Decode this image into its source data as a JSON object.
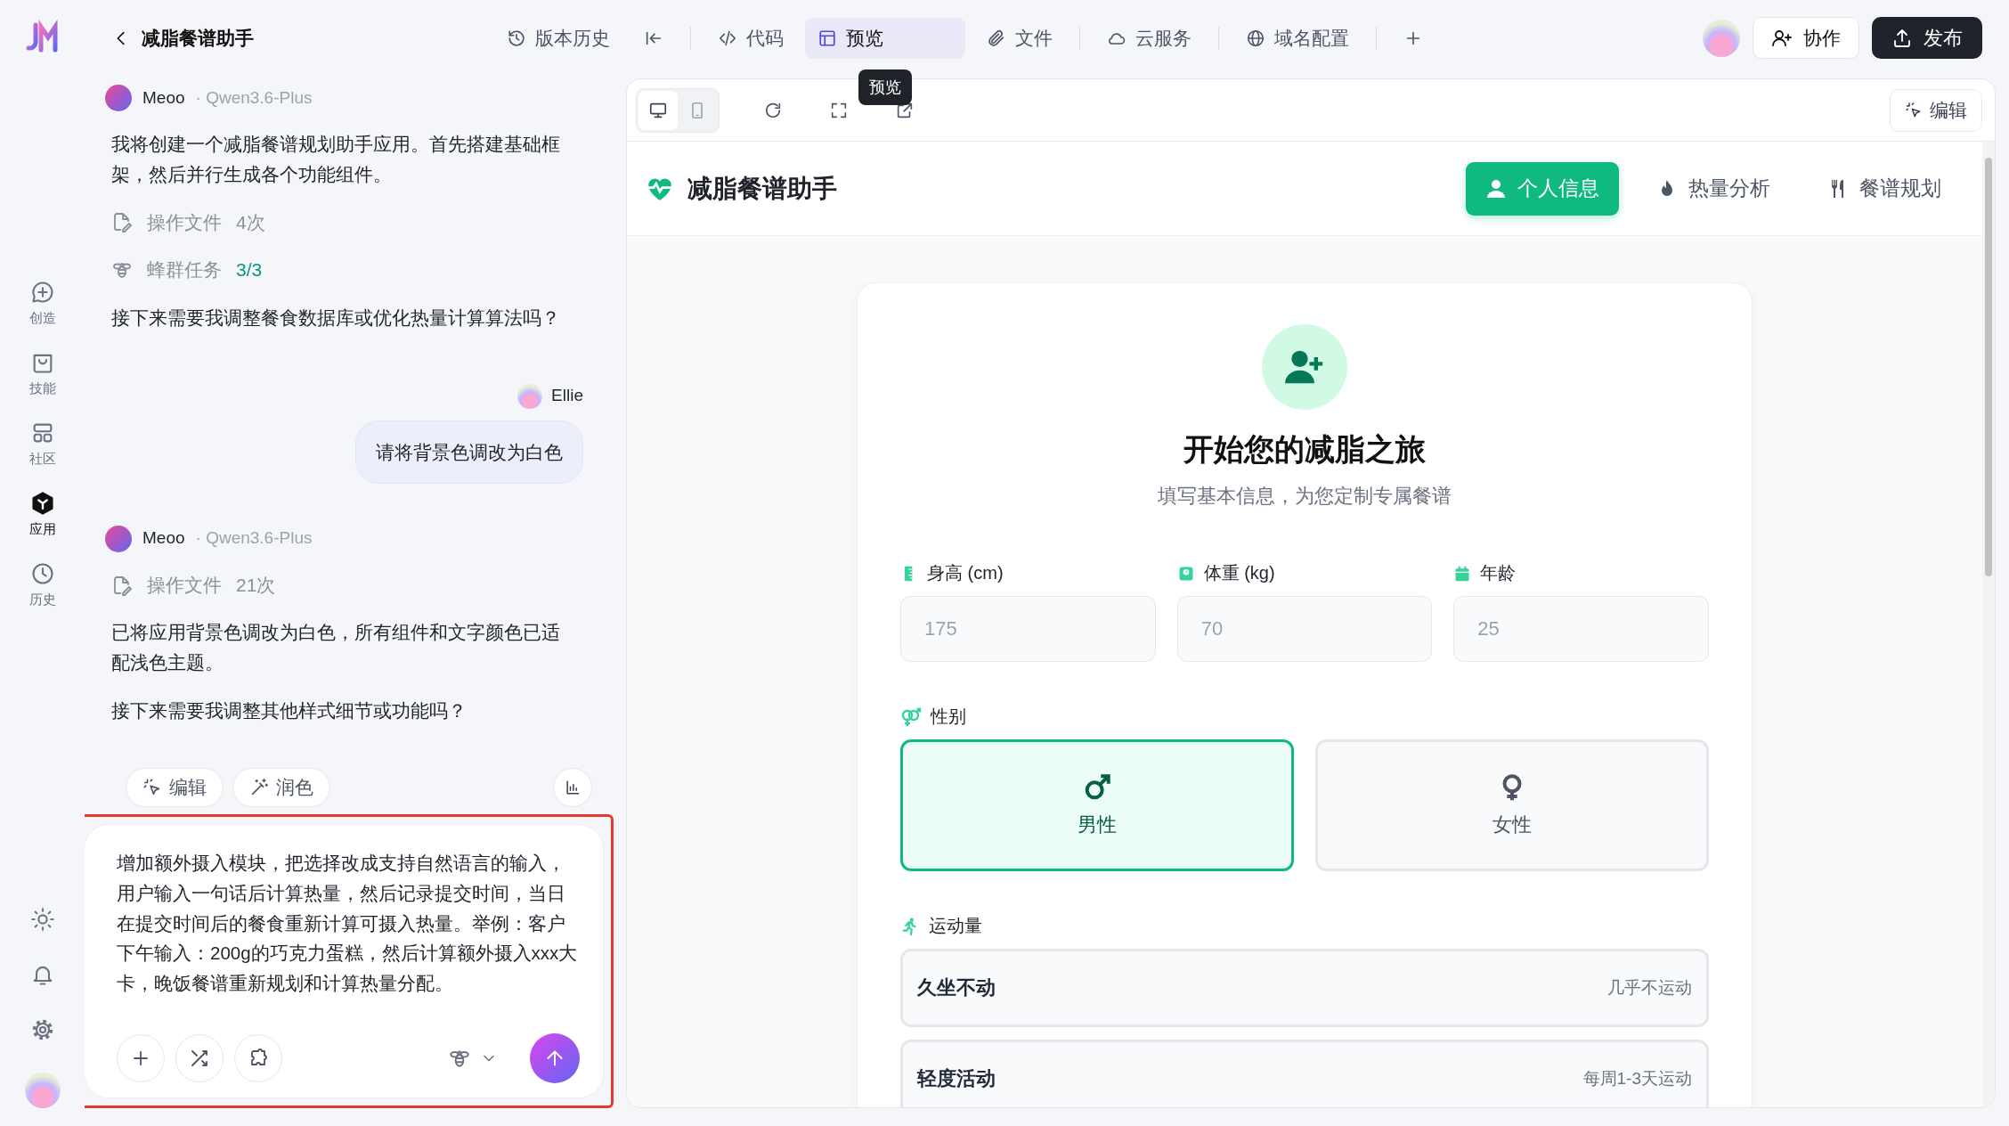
{
  "rail": {
    "nav": [
      {
        "kind": "create",
        "label": "创造",
        "selected": false
      },
      {
        "kind": "skills",
        "label": "技能",
        "selected": false
      },
      {
        "kind": "community",
        "label": "社区",
        "selected": false
      },
      {
        "kind": "apps",
        "label": "应用",
        "selected": true
      },
      {
        "kind": "history",
        "label": "历史",
        "selected": false
      }
    ]
  },
  "header": {
    "title": "减脂餐谱助手",
    "toolbar": [
      {
        "kind": "history",
        "label": "版本历史",
        "selected": false
      },
      {
        "kind": "collapse",
        "selected": false
      },
      {
        "kind": "code",
        "label": "代码",
        "selected": false
      },
      {
        "kind": "preview",
        "label": "预览",
        "selected": true
      },
      {
        "kind": "files",
        "label": "文件",
        "selected": false
      },
      {
        "kind": "cloud",
        "label": "云服务",
        "selected": false
      },
      {
        "kind": "domain",
        "label": "域名配置",
        "selected": false
      },
      {
        "kind": "add",
        "selected": false
      }
    ],
    "tooltip": "预览",
    "collab_button": "协作",
    "publish_button": "发布"
  },
  "chat": {
    "messages": [
      {
        "kind": "assistant",
        "author": "Meoo",
        "model": "· Qwen3.6-Plus",
        "items": [
          {
            "kind": "text",
            "text": "我将创建一个减脂餐谱规划助手应用。首先搭建基础框架，然后并行生成各个功能组件。"
          },
          {
            "kind": "file_ops",
            "label": "操作文件",
            "count": "4次"
          },
          {
            "kind": "swarm",
            "label": "蜂群任务",
            "count": "3/3",
            "done": true
          },
          {
            "kind": "text",
            "text": "接下来需要我调整餐食数据库或优化热量计算算法吗？"
          }
        ]
      },
      {
        "kind": "user",
        "author": "Ellie",
        "text": "请将背景色调改为白色"
      },
      {
        "kind": "assistant",
        "author": "Meoo",
        "model": "· Qwen3.6-Plus",
        "items": [
          {
            "kind": "file_ops",
            "label": "操作文件",
            "count": "21次"
          },
          {
            "kind": "text",
            "text": "已将应用背景色调改为白色，所有组件和文字颜色已适配浅色主题。"
          },
          {
            "kind": "text",
            "text": "接下来需要我调整其他样式细节或功能吗？"
          }
        ]
      }
    ],
    "actions": [
      {
        "kind": "edit",
        "label": "编辑"
      },
      {
        "kind": "polish",
        "label": "润色"
      }
    ],
    "input": {
      "value": "增加额外摄入模块，把选择改成支持自然语言的输入，用户输入一句话后计算热量，然后记录提交时间，当日在提交时间后的餐食重新计算可摄入热量。举例：客户下午输入：200g的巧克力蛋糕，然后计算额外摄入xxx大卡，晚饭餐谱重新规划和计算热量分配。"
    }
  },
  "preview": {
    "devices": [
      {
        "kind": "desktop",
        "selected": true
      },
      {
        "kind": "mobile",
        "selected": false
      }
    ],
    "edit_button": "编辑",
    "app": {
      "title": "减脂餐谱助手",
      "tabs": [
        {
          "kind": "profile",
          "label": "个人信息",
          "selected": true
        },
        {
          "kind": "calories",
          "label": "热量分析",
          "selected": false
        },
        {
          "kind": "meals",
          "label": "餐谱规划",
          "selected": false
        }
      ],
      "heading": "开始您的减脂之旅",
      "subtitle": "填写基本信息，为您定制专属餐谱",
      "fields": [
        {
          "kind": "height",
          "label": "身高 (cm)",
          "placeholder": "175"
        },
        {
          "kind": "weight",
          "label": "体重 (kg)",
          "placeholder": "70"
        },
        {
          "kind": "age",
          "label": "年龄",
          "placeholder": "25"
        }
      ],
      "gender_label": "性别",
      "genders": [
        {
          "kind": "male",
          "label": "男性",
          "selected": true
        },
        {
          "kind": "female",
          "label": "女性",
          "selected": false
        }
      ],
      "activity_label": "运动量",
      "activities": [
        {
          "title": "久坐不动",
          "note": "几乎不运动",
          "selected": false
        },
        {
          "title": "轻度活动",
          "note": "每周1-3天运动",
          "selected": false
        }
      ]
    }
  }
}
